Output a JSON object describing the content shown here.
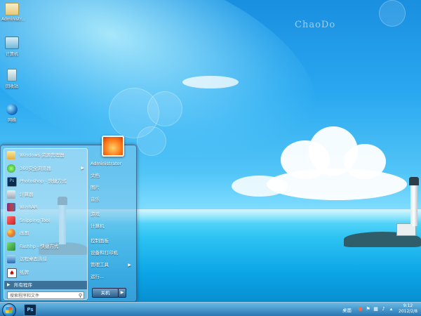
{
  "desktop": {
    "brand": "ChaoDo",
    "icons": [
      {
        "label": "Administr...",
        "icon": "folder-icon"
      },
      {
        "label": "计算机",
        "icon": "computer-icon"
      },
      {
        "label": "回收站",
        "icon": "recycle-bin-icon"
      },
      {
        "label": "网络",
        "icon": "network-icon"
      }
    ]
  },
  "start_menu": {
    "programs": [
      {
        "label": "Windows 资源管理器",
        "icon": "explorer-icon",
        "has_arrow": false
      },
      {
        "label": "360安全浏览器",
        "icon": "browser-icon",
        "has_arrow": true
      },
      {
        "label": "Photoshop - 快捷方式",
        "icon": "photoshop-icon",
        "has_arrow": false
      },
      {
        "label": "计算器",
        "icon": "calculator-icon",
        "has_arrow": false
      },
      {
        "label": "WinRAR",
        "icon": "winrar-icon",
        "has_arrow": false
      },
      {
        "label": "Snipping Tool",
        "icon": "snipping-tool-icon",
        "has_arrow": false
      },
      {
        "label": "画图",
        "icon": "paint-icon",
        "has_arrow": false
      },
      {
        "label": "Fashhp - 快捷方式",
        "icon": "shortcut-icon",
        "has_arrow": false
      },
      {
        "label": "远程桌面连接",
        "icon": "remote-desktop-icon",
        "has_arrow": false
      },
      {
        "label": "纸牌",
        "icon": "solitaire-icon",
        "has_arrow": false
      }
    ],
    "all_programs": "所有程序",
    "search_placeholder": "搜索程序和文件",
    "right_items": [
      {
        "label": "Administrator"
      },
      {
        "label": "文档"
      },
      {
        "label": "图片"
      },
      {
        "label": "音乐"
      },
      {
        "label": "游戏"
      },
      {
        "label": "计算机"
      },
      {
        "label": "控制面板"
      },
      {
        "label": "设备和打印机"
      },
      {
        "label": "管理工具",
        "has_arrow": true
      },
      {
        "label": "运行..."
      }
    ],
    "shutdown_label": "关机"
  },
  "taskbar": {
    "start_button": "start-orb-icon",
    "pinned": [
      {
        "label": "Ps",
        "icon": "photoshop-icon"
      }
    ],
    "tray_label": "桌面",
    "time": "9:12",
    "date": "2012/2/8"
  }
}
